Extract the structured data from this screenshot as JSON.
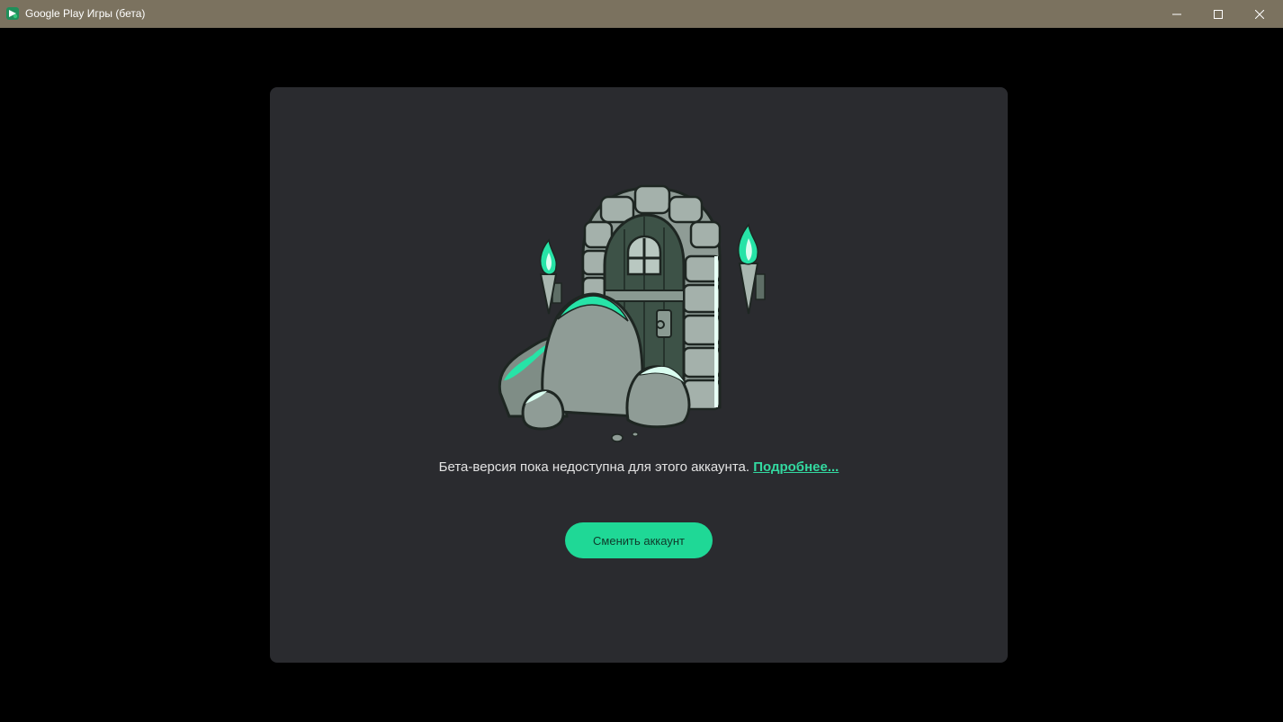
{
  "window": {
    "title": "Google Play Игры (бета)"
  },
  "icons": {
    "app": "google-play-games-icon",
    "minimize": "minimize-icon",
    "maximize": "maximize-icon",
    "close": "close-icon",
    "illustration": "locked-dungeon-door-illustration"
  },
  "main": {
    "message_text": "Бета-версия пока недоступна для этого аккаунта.",
    "learn_more_link": "Подробнее...",
    "switch_account_button": "Сменить аккаунт"
  },
  "colors": {
    "titlebar": "#7b725f",
    "background": "#000000",
    "card": "#2a2b2f",
    "accent": "#1fd896",
    "link": "#33d9a0"
  }
}
